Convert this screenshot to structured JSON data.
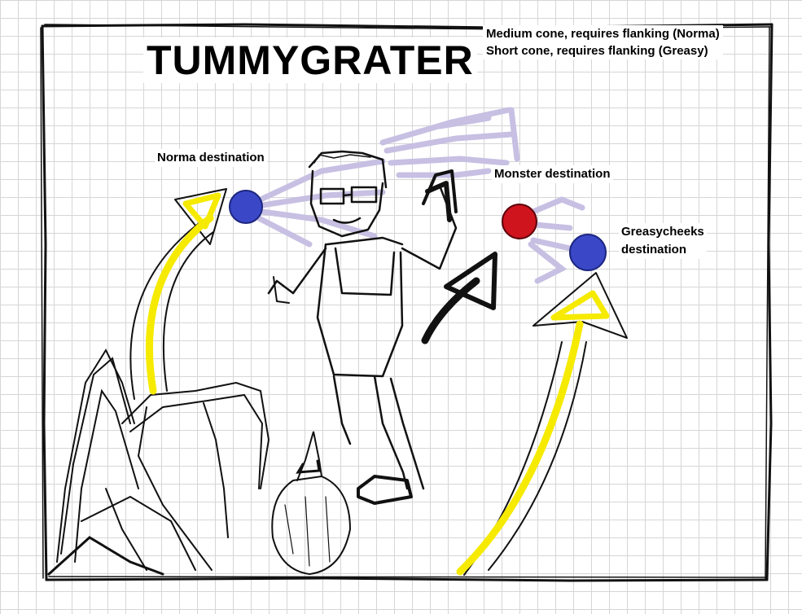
{
  "title": "TUMMYGRATER",
  "notes": [
    "Medium cone, requires flanking (Norma)",
    "Short cone, requires flanking (Greasy)"
  ],
  "labels": {
    "norma": "Norma destination",
    "monster": "Monster destination",
    "greasy_line1": "Greasycheeks",
    "greasy_line2": "destination"
  },
  "colors": {
    "norma_marker": "#3a48c8",
    "greasy_marker": "#3a48c8",
    "monster_marker": "#d0141e",
    "cone": "#c7c0e3",
    "arrow_player": "#f5ea00",
    "arrow_monster": "#000000",
    "sketch": "#111111"
  }
}
